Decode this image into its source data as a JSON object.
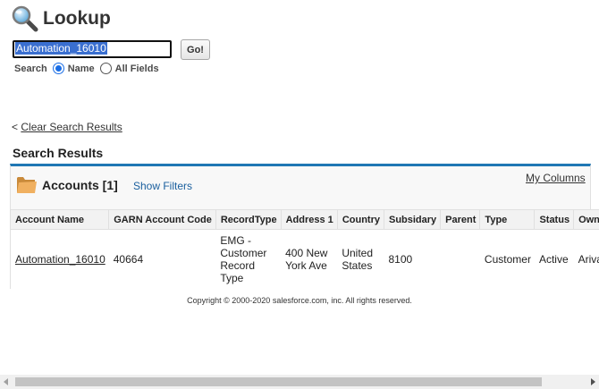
{
  "header": {
    "title": "Lookup",
    "icon": "magnifier-icon"
  },
  "search": {
    "value": "Automation_16010",
    "go_label": "Go!",
    "scope_label": "Search",
    "option_name": "Name",
    "option_all": "All Fields",
    "selected": "Name"
  },
  "nav": {
    "prefix": "<",
    "clear_label": "Clear Search Results"
  },
  "results": {
    "heading": "Search Results",
    "object_label": "Accounts [1]",
    "show_filters_label": "Show Filters",
    "my_columns_label": "My Columns",
    "columns": [
      "Account Name",
      "GARN Account Code",
      "RecordType",
      "Address 1",
      "Country",
      "Subsidary",
      "Parent",
      "Type",
      "Status",
      "Owner L"
    ],
    "rows": [
      {
        "cells": [
          "Automation_16010",
          "40664",
          "EMG - Customer Record Type",
          "400 New York Ave",
          "United States",
          "8100",
          "",
          "Customer",
          "Active",
          "Arivalag"
        ]
      }
    ]
  },
  "footer": {
    "copyright": "Copyright © 2000-2020 salesforce.com, inc. All rights reserved."
  },
  "colors": {
    "accent": "#1f77b4",
    "link": "#1a5f9e",
    "selection": "#3a6fd0"
  }
}
